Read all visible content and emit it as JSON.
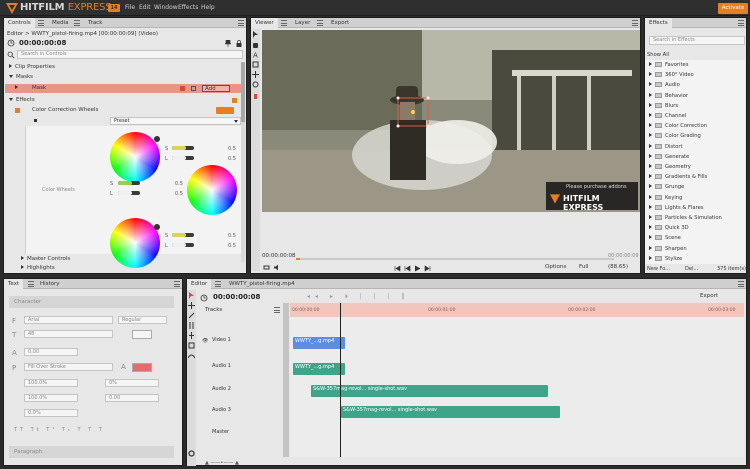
{
  "app": {
    "name": "HITFILM",
    "name2": "EXPRESS",
    "badge": "14",
    "activate_label": "Activate"
  },
  "menu": [
    "File",
    "Edit",
    "Window",
    "Effects",
    "Help"
  ],
  "controls_panel": {
    "tabs": [
      "Controls",
      "Media",
      "Track"
    ],
    "breadcrumb": "Editor > WWTY_pistol-firing.mp4 [00:00:00:09] (Video)",
    "timecode": "00:00:00:08",
    "search_placeholder": "Search in Controls",
    "sections": {
      "clip_properties": "Clip Properties",
      "masks": "Masks",
      "mask": "Mask",
      "mask_mode": "Add",
      "effects": "Effects",
      "effect_name": "Color Correction Wheels",
      "preset_label": "Preset",
      "color_wheels_label": "Color Wheels",
      "master_controls": "Master Controls",
      "highlights": "Highlights"
    },
    "wheel_values": {
      "s": "S",
      "l": "L",
      "v1": "0.5",
      "v2": "0.5",
      "v3": "0.5",
      "v4": "0.5",
      "v5": "0.5",
      "v6": "0.5"
    }
  },
  "viewer": {
    "tabs": [
      "Viewer",
      "Layer",
      "Export"
    ],
    "watermark_text": "Please purchase addons",
    "watermark_brand": "HITFILM EXPRESS",
    "timecode_start": "00:00:00:08",
    "timecode_end": "00:00:00:09",
    "options_label": "Options",
    "quality_label": "Full",
    "zoom_label": "(88.65)"
  },
  "effects_panel": {
    "title": "Effects",
    "search_placeholder": "Search in Effects",
    "filter": "Show All",
    "items": [
      "Favorites",
      "360° Video",
      "Audio",
      "Behavior",
      "Blurs",
      "Channel",
      "Color Correction",
      "Color Grading",
      "Distort",
      "Generate",
      "Geometry",
      "Gradients & Fills",
      "Grunge",
      "Keying",
      "Lights & Flares",
      "Particles & Simulation",
      "Quick 3D",
      "Scene",
      "Sharpen",
      "Stylize"
    ],
    "new_folder": "New Fo...",
    "delete": "Del...",
    "count": "375 item(s)"
  },
  "text_panel": {
    "tabs": [
      "Text",
      "History"
    ],
    "character_label": "Character",
    "font": "Arial",
    "style": "Regular",
    "size": "48",
    "leading": "0.00",
    "fill_mode": "Fill Over Stroke",
    "scale_h": "100.0%",
    "tracking": "0%",
    "scale_v": "100.0%",
    "baseline": "0.00",
    "tsume": "0.0%",
    "paragraph_label": "Paragraph",
    "fill_color": "#f5f5f5",
    "stroke_color": "#e86a6a"
  },
  "editor": {
    "tabs": [
      "Editor",
      "WWTY_pistol-firing.mp4"
    ],
    "timecode": "00:00:00:08",
    "export_label": "Export",
    "tracks_label": "Tracks",
    "ruler": [
      "00:00:00:00",
      "00:00:01:00",
      "00:00:02:00",
      "00:00:03:00"
    ],
    "tracks": [
      {
        "name": "Video 1",
        "kind": "video"
      },
      {
        "name": "Audio 1",
        "kind": "audio"
      },
      {
        "name": "Audio 2",
        "kind": "audio"
      },
      {
        "name": "Audio 3",
        "kind": "audio"
      },
      {
        "name": "Master",
        "kind": "master"
      }
    ],
    "clips": {
      "video1": "WWTY_...g.mp4",
      "audio1": "WWTY_...g.mp4",
      "audio2": "S&W-357mag-revol... single-shot.wav",
      "audio3": "S&W-357mag-revol... single-shot.wav"
    }
  },
  "colors": {
    "accent": "#e67e22",
    "video_clip": "#5c8de0",
    "audio_clip": "#3fa58a",
    "ruler_bg": "#f1c7bd",
    "mask_row": "#e8968a"
  }
}
